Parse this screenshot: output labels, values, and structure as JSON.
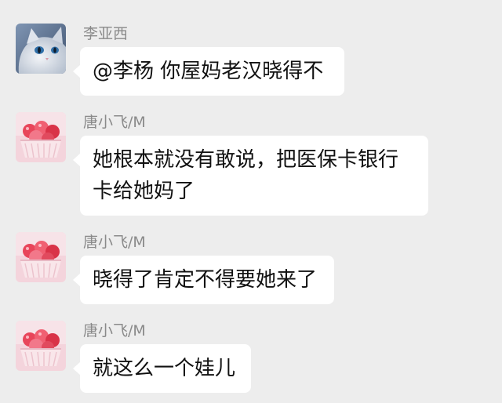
{
  "messages": [
    {
      "sender": "李亚西",
      "avatar_icon": "cat-avatar-icon",
      "lines": [
        "@李杨  你屋妈老汉晓得不"
      ]
    },
    {
      "sender": "唐小飞/M",
      "avatar_icon": "candy-avatar-icon",
      "lines": [
        "她根本就没有敢说，把医保卡银行",
        "卡给她妈了"
      ]
    },
    {
      "sender": "唐小飞/M",
      "avatar_icon": "candy-avatar-icon",
      "lines": [
        "晓得了肯定不得要她来了"
      ]
    },
    {
      "sender": "唐小飞/M",
      "avatar_icon": "candy-avatar-icon",
      "lines": [
        "就这么一个娃儿"
      ]
    }
  ],
  "colors": {
    "background": "#ededed",
    "bubble": "#ffffff",
    "sender_name": "#8a8a8a",
    "text": "#111111"
  }
}
